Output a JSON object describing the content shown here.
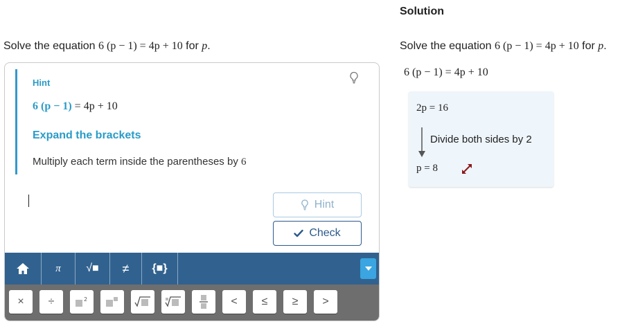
{
  "question": {
    "prefix": "Solve the equation ",
    "equation": "6 (p − 1) = 4p + 10",
    "middle": " for ",
    "variable": "p",
    "suffix": "."
  },
  "hint": {
    "title": "Hint",
    "equation_left": "6 (p − 1)",
    "equation_right": " = 4p + 10",
    "heading": "Expand the brackets",
    "text": "Multiply each term inside the parentheses by ",
    "text_number": "6",
    "icon": "lightbulb-icon"
  },
  "buttons": {
    "hint_label": "Hint",
    "check_label": "Check"
  },
  "keyboard": {
    "tabs": [
      "π",
      "√■",
      "≠",
      "{■}"
    ],
    "keys": [
      "×",
      "÷",
      "■²",
      "■■",
      "√■",
      "∜■",
      "fraction",
      "<",
      "≤",
      "≥",
      ">"
    ],
    "toolbar_color": "#31628f",
    "dropdown_color": "#3aa5e0"
  },
  "solution": {
    "title": "Solution",
    "question_prefix": "Solve the equation ",
    "question_equation": "6 (p − 1) = 4p + 10",
    "question_middle": " for ",
    "question_variable": "p",
    "question_suffix": ".",
    "equation": "6 (p − 1) = 4p + 10",
    "step_from": "2p = 16",
    "step_text": "Divide both sides by 2",
    "step_to": "p = 8"
  },
  "colors": {
    "accent": "#2a9bc7",
    "check": "#2c5a8a",
    "expand_icon": "#8b1a1a"
  }
}
